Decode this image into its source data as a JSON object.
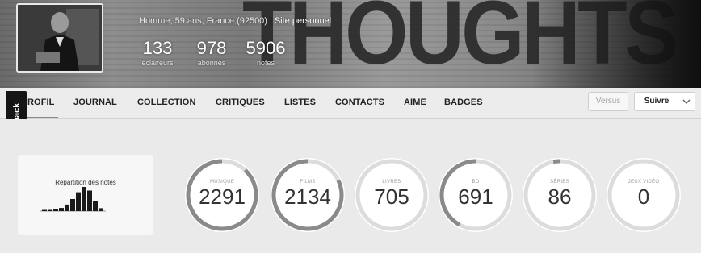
{
  "profile": {
    "info": "Homme, 59 ans, France (92500)",
    "separator": "|",
    "site_link": "Site personnel",
    "banner_text": "THOUGHTS"
  },
  "stats": [
    {
      "value": "133",
      "label": "éclaireurs"
    },
    {
      "value": "978",
      "label": "abonnés"
    },
    {
      "value": "5906",
      "label": "notes"
    }
  ],
  "nav": {
    "items": [
      {
        "label": "ROFIL",
        "active": true
      },
      {
        "label": "JOURNAL"
      },
      {
        "label": "COLLECTION"
      },
      {
        "label": "CRITIQUES"
      },
      {
        "label": "LISTES"
      },
      {
        "label": "CONTACTS"
      },
      {
        "label": "AIME"
      },
      {
        "label": "BADGES"
      }
    ],
    "versus_label": "Versus",
    "follow_label": "Suivre",
    "dropdown_icon": "chevron-down-icon"
  },
  "feedback_label": "Feedback",
  "distribution": {
    "title": "Répartition des notes",
    "bars": [
      0.02,
      0.03,
      0.07,
      0.13,
      0.27,
      0.5,
      0.78,
      1.0,
      0.85,
      0.4,
      0.12
    ]
  },
  "categories": [
    {
      "label": "MUSIQUE",
      "value": "2291",
      "progress": 0.88
    },
    {
      "label": "FILMS",
      "value": "2134",
      "progress": 0.82
    },
    {
      "label": "LIVRES",
      "value": "705",
      "progress": 0.0
    },
    {
      "label": "BD",
      "value": "691",
      "progress": 0.42
    },
    {
      "label": "SÉRIES",
      "value": "86",
      "progress": 0.03
    },
    {
      "label": "JEUX VIDÉO",
      "value": "0",
      "progress": 0.0
    }
  ],
  "colors": {
    "ring_track": "#dcdcdc",
    "ring_fill": "#8a8a8a",
    "circle_bg": "#ffffff"
  }
}
